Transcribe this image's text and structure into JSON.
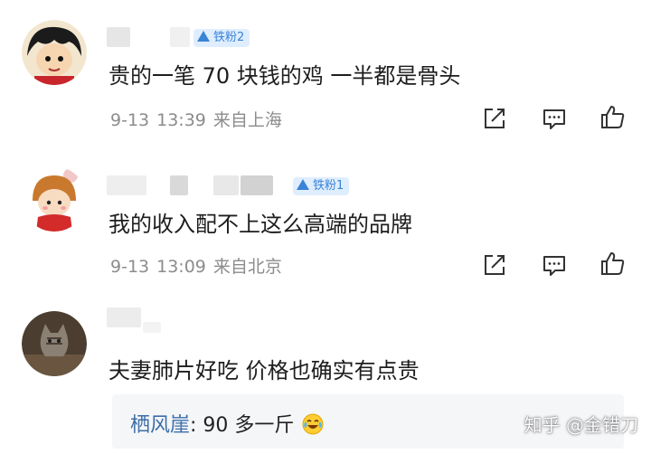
{
  "comments": [
    {
      "fan_badge": "铁粉2",
      "text": "贵的一笔 70 块钱的鸡 一半都是骨头",
      "date": "9-13",
      "time": "13:39",
      "location": "来自上海"
    },
    {
      "fan_badge": "铁粉1",
      "text": "我的收入配不上这么高端的品牌",
      "date": "9-13",
      "time": "13:09",
      "location": "来自北京"
    },
    {
      "text": "夫妻肺片好吃   价格也确实有点贵",
      "reply": {
        "author": "栖风崖",
        "text": ": 90 多一斤"
      }
    }
  ],
  "icons": {
    "share": "share-icon",
    "comment": "comment-icon",
    "like": "like-icon",
    "emoji": "laugh-cry-emoji"
  },
  "watermark": "知乎 @金错刀",
  "colors": {
    "badge_bg": "#dfeeff",
    "badge_text": "#3a83d6",
    "reply_author": "#3c6da8",
    "meta_text": "#8c8c8c"
  }
}
